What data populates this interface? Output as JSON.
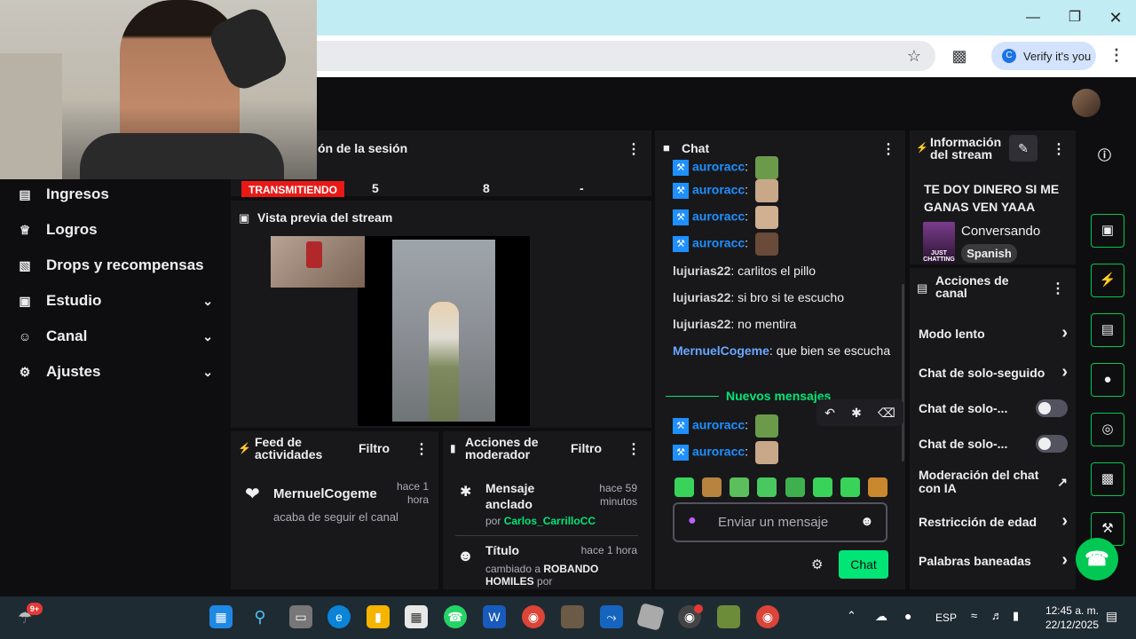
{
  "browser": {
    "verify_label": "Verify it's you",
    "verify_avatar": "C",
    "icons": [
      "minimize-icon",
      "maximize-icon",
      "close-icon",
      "star-icon",
      "extensions-icon",
      "kebab-icon"
    ]
  },
  "nav": {
    "items": [
      {
        "label": "Ingresos",
        "icon": "chart-icon"
      },
      {
        "label": "Logros",
        "icon": "trophy-icon"
      },
      {
        "label": "Drops y recompensas",
        "icon": "gift-icon"
      },
      {
        "label": "Estudio",
        "icon": "camera-icon"
      },
      {
        "label": "Canal",
        "icon": "users-icon"
      },
      {
        "label": "Ajustes",
        "icon": "gear-icon"
      }
    ]
  },
  "session": {
    "title": "ón de la sesión",
    "status": "TRANSMITIENDO",
    "stats": [
      "5",
      "8",
      "-"
    ]
  },
  "preview": {
    "title": "Vista previa del stream"
  },
  "activity": {
    "title": "Feed de actividades",
    "filter": "Filtro",
    "user": "MernuelCogeme",
    "time": "hace 1 hora",
    "desc": "acaba de seguir el canal"
  },
  "modactions": {
    "title": "Acciones de moderador",
    "filter": "Filtro",
    "item1_title": "Mensaje anclado",
    "item1_time": "hace 59 minutos",
    "item1_by_prefix": "por",
    "item1_by": "Carlos_CarrilloCC",
    "item2_title": "Título",
    "item2_time": "hace 1 hora",
    "item2_desc_prefix": "cambiado a",
    "item2_desc": "ROBANDO HOMILES",
    "item2_desc_suffix": "por"
  },
  "chat": {
    "title": "Chat",
    "lines": [
      {
        "user": "auroracc",
        "emote": true
      },
      {
        "user": "auroracc",
        "emote": true
      },
      {
        "user": "auroracc",
        "emote": true
      },
      {
        "user": "auroracc",
        "emote": true
      },
      {
        "user": "lujurias22",
        "text": "carlitos el pillo"
      },
      {
        "user": "lujurias22",
        "text": "si bro si te escucho"
      },
      {
        "user": "lujurias22",
        "text": "no mentira"
      },
      {
        "user": "MernuelCogeme",
        "text": "que bien se escucha"
      }
    ],
    "new_messages": "Nuevos mensajes",
    "after": [
      {
        "user": "auroracc",
        "emote": true
      },
      {
        "user": "auroracc",
        "emote": true
      }
    ],
    "input_placeholder": "Enviar un mensaje",
    "send_label": "Chat"
  },
  "stream_info": {
    "title": "Información del stream",
    "stream_title": "TE DOY DINERO SI ME GANAS VEN YAAA",
    "category": "Conversando",
    "category_art": "JUST CHATTING",
    "language": "Spanish"
  },
  "channel_actions": {
    "title": "Acciones de canal",
    "items": [
      {
        "label": "Modo lento",
        "kind": "arrow"
      },
      {
        "label": "Chat de solo-seguido",
        "kind": "arrow"
      },
      {
        "label": "Chat de solo-...",
        "kind": "toggle"
      },
      {
        "label": "Chat de solo-...",
        "kind": "toggle"
      },
      {
        "label": "Moderación del chat con IA",
        "kind": "external"
      },
      {
        "label": "Restricción de edad",
        "kind": "arrow"
      },
      {
        "label": "Palabras baneadas",
        "kind": "arrow"
      }
    ]
  },
  "taskbar": {
    "notification_badge": "9+",
    "lang": "ESP",
    "time": "12:45 a. m.",
    "date": "22/12/2025"
  },
  "colors": {
    "accent": "#00e676",
    "live": "#e91916",
    "twitch_bg": "#0e0e10",
    "panel": "#18181b"
  }
}
